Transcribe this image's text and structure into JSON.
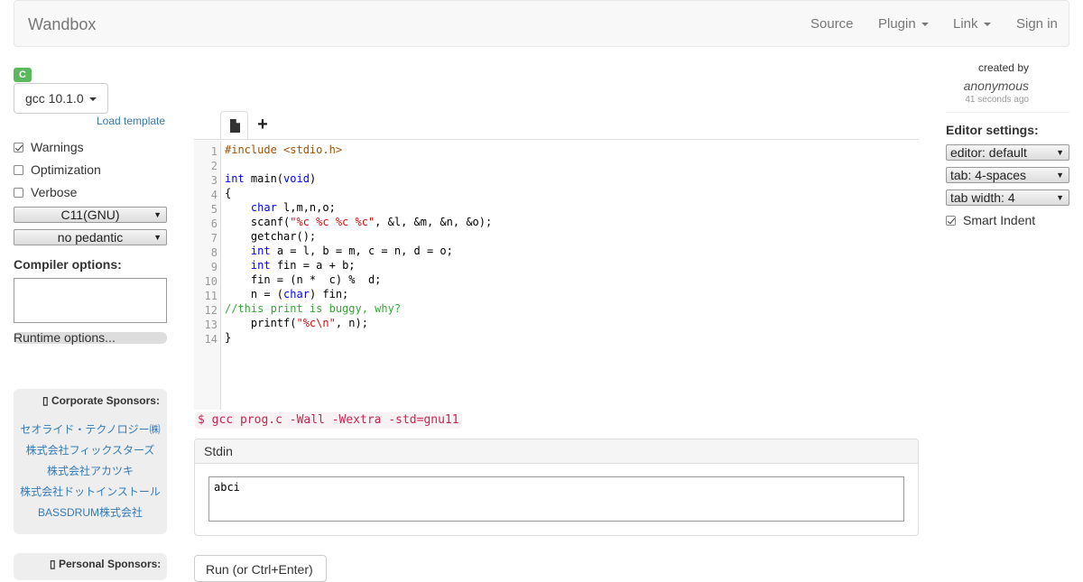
{
  "navbar": {
    "brand": "Wandbox",
    "items": [
      "Source",
      "Plugin",
      "Link",
      "Sign in"
    ]
  },
  "compiler": {
    "language_badge": "C",
    "selected": "gcc 10.1.0",
    "load_template": "Load template",
    "options": [
      {
        "label": "Warnings",
        "checked": true
      },
      {
        "label": "Optimization",
        "checked": false
      },
      {
        "label": "Verbose",
        "checked": false
      }
    ],
    "std_select": "C11(GNU)",
    "pedantic_select": "no pedantic",
    "compiler_options_label": "Compiler options:",
    "compiler_options_value": "",
    "runtime_options_label": "Runtime options..."
  },
  "sponsors": {
    "corporate_title": "Corporate Sponsors:",
    "corporate": [
      "セオライド・テクノロジー㈱",
      "株式会社フィックスターズ",
      "株式会社アカツキ",
      "株式会社ドットインストール",
      "BASSDRUM株式会社"
    ],
    "personal_title": "Personal Sponsors:"
  },
  "editor": {
    "add_tab_label": "+",
    "line_numbers": [
      "1",
      "2",
      "3",
      "4",
      "5",
      "6",
      "7",
      "8",
      "9",
      "10",
      "11",
      "12",
      "13",
      "14"
    ],
    "code_lines": [
      "#include <stdio.h>",
      "",
      "int main(void)",
      "{",
      "    char l,m,n,o;",
      "    scanf(\"%c %c %c %c\", &l, &m, &n, &o);",
      "    getchar();",
      "    int a = l, b = m, c = n, d = o;",
      "    int fin = a + b;",
      "    fin = (n *  c) %  d;",
      "    n = (char) fin;",
      "//this print is buggy, why?",
      "    printf(\"%c\\n\", n);",
      "}"
    ]
  },
  "command_line": "$ gcc prog.c -Wall -Wextra -std=gnu11",
  "stdin": {
    "title": "Stdin",
    "value": "abci"
  },
  "run_button": "Run (or Ctrl+Enter)",
  "author_info": {
    "created_by": "created by",
    "author": "anonymous",
    "time_ago": "41 seconds ago"
  },
  "editor_settings": {
    "title": "Editor settings:",
    "editor_mode": "editor: default",
    "tab_mode": "tab: 4-spaces",
    "tab_width": "tab width: 4",
    "smart_indent_label": "Smart Indent",
    "smart_indent_checked": true
  },
  "colors": {
    "badge_green": "#5cb85c",
    "link_blue": "#337ab7",
    "command_red": "#c7254e",
    "keyword_blue": "#0000ff",
    "string_red": "#cc1111",
    "comment_green": "#33aa33"
  }
}
